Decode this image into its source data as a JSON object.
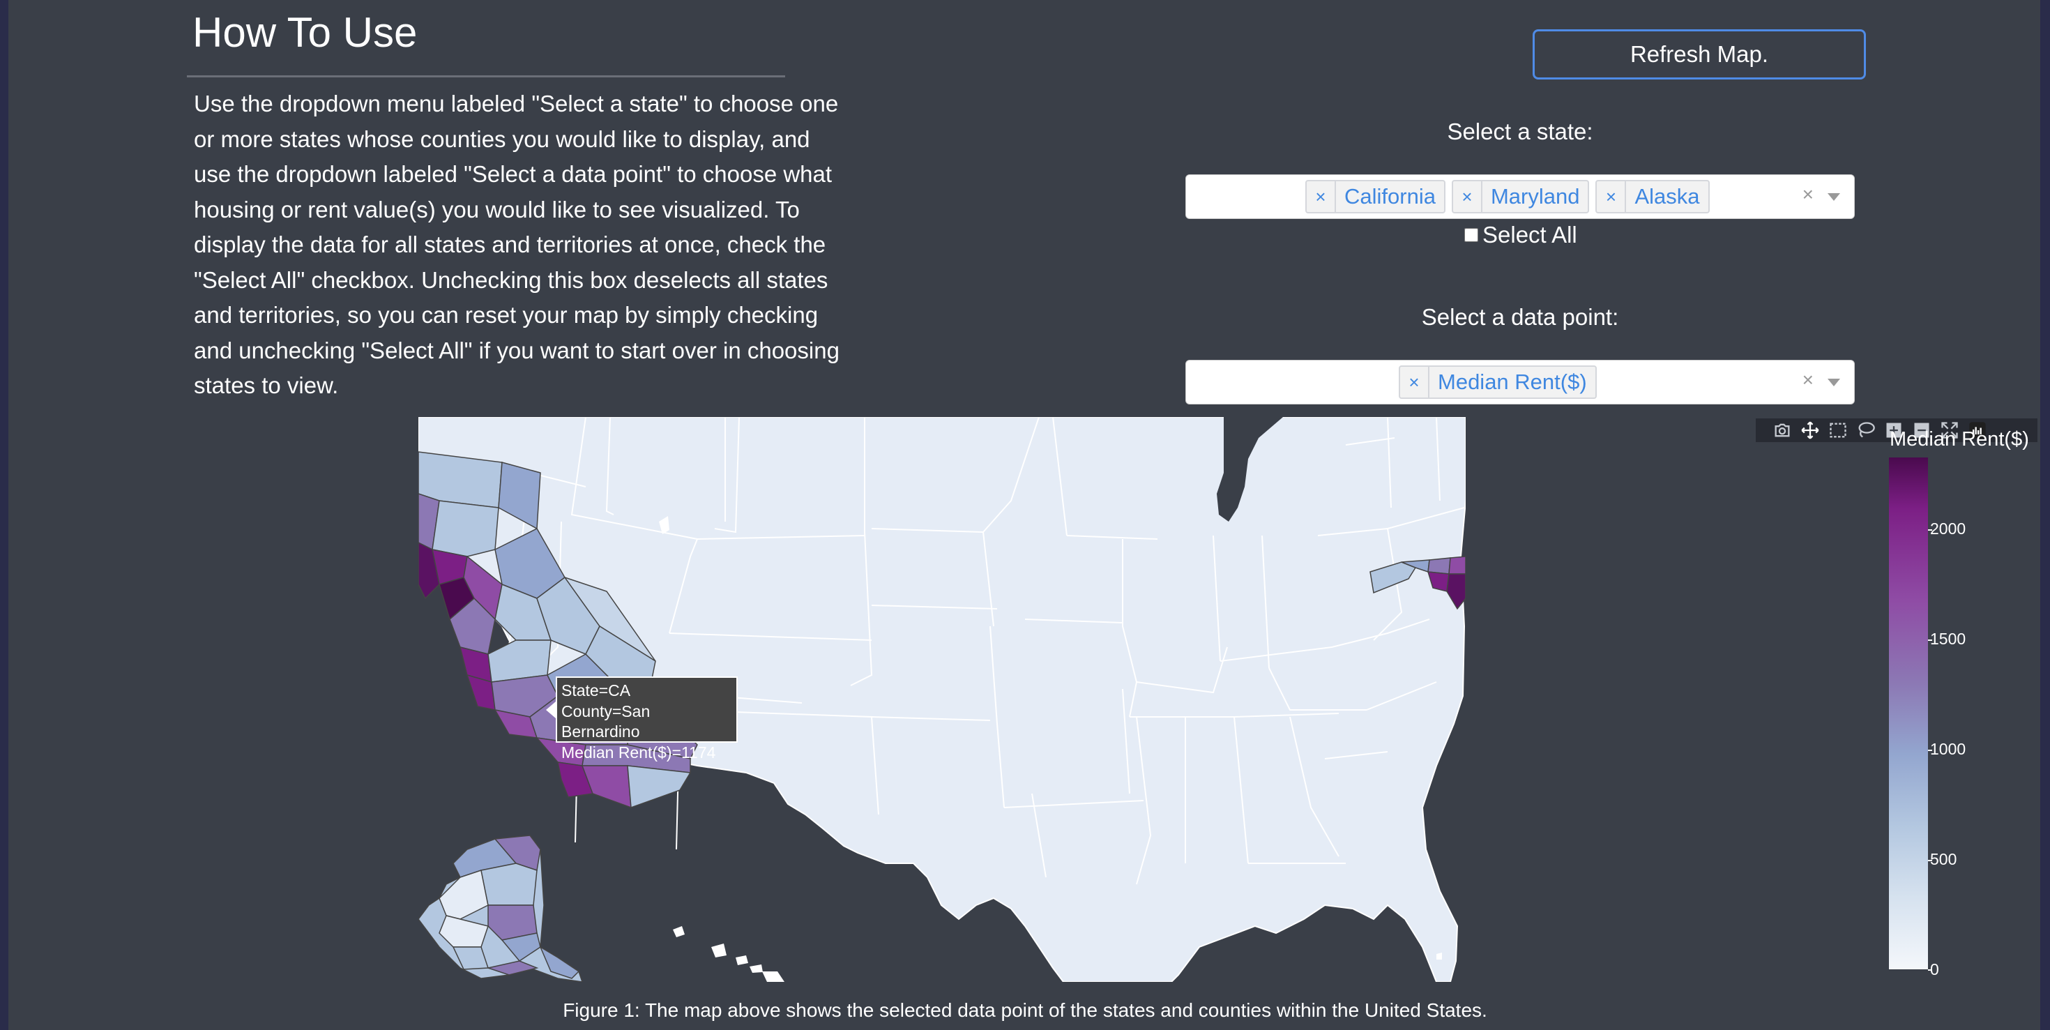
{
  "instructions": {
    "heading": "How To Use",
    "lines": [
      "Use the dropdown menu labeled \"Select a state\" to choose one",
      "or more states whose counties you would like to display, and",
      "use the dropdown labeled \"Select a data point\" to choose what",
      "housing or rent value(s) you would like to see visualized. To",
      "display the data for all states and territories at once, check the",
      "\"Select All\" checkbox. Unchecking this box deselects all states",
      "and territories, so you can reset your map by simply checking",
      "and unchecking \"Select All\" if you want to start over in choosing",
      "states to view."
    ]
  },
  "controls": {
    "refresh_label": "Refresh Map.",
    "state_label": "Select a state:",
    "state_selected": [
      "California",
      "Maryland",
      "Alaska"
    ],
    "select_all_label": "Select All",
    "select_all_checked": false,
    "datapoint_label": "Select a data point:",
    "datapoint_selected": [
      "Median Rent($)"
    ],
    "chip_remove_glyph": "×",
    "clear_glyph": "×"
  },
  "modebar": {
    "icons": [
      "camera-icon",
      "pan-icon",
      "box-select-icon",
      "lasso-icon",
      "zoom-in-icon",
      "zoom-out-icon",
      "autoscale-icon",
      "plotly-logo-icon"
    ]
  },
  "colorbar": {
    "title": "Median Rent($)",
    "ticks": [
      "2000",
      "1500",
      "1000",
      "500",
      "0"
    ]
  },
  "tooltip": {
    "state": "State=CA",
    "county": "County=San Bernardino",
    "value": "Median Rent($)=1174"
  },
  "caption": "Figure 1: The map above shows the selected data point of the states and counties within the United States.",
  "colors": {
    "page_bg": "#3a3f48",
    "map_land": "#e5ecf6",
    "accent_link": "#3f87e0",
    "button_border": "#4f8be6"
  }
}
